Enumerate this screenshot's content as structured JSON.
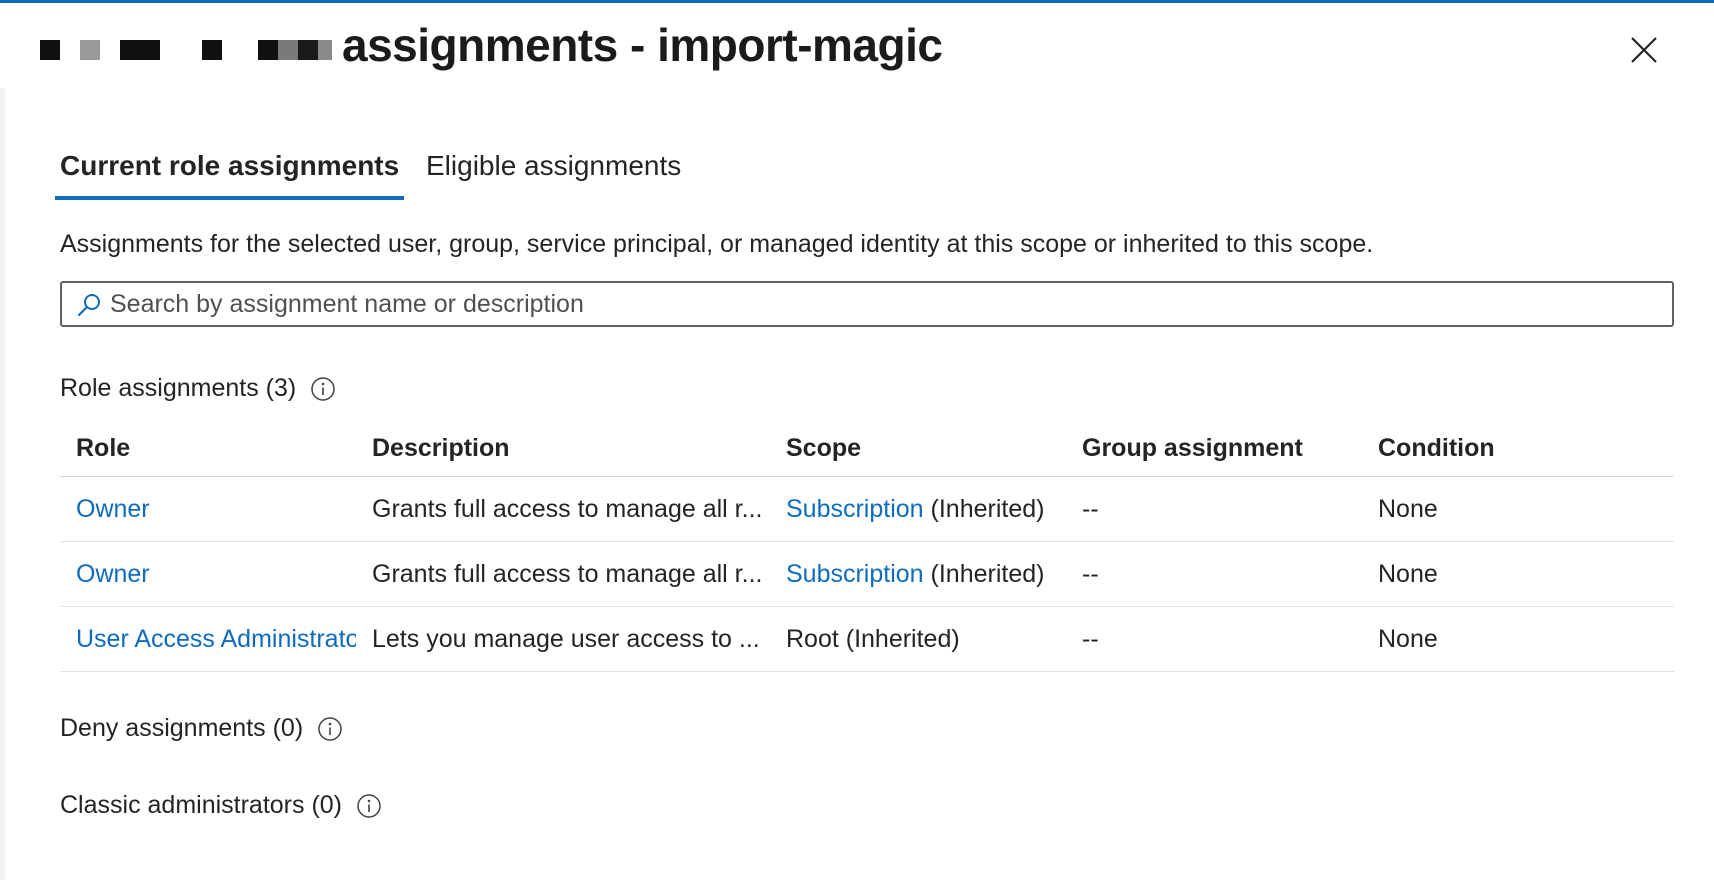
{
  "header": {
    "title": "assignments - import-magic",
    "close_icon": "close-icon",
    "accent_color": "#0f6cbd"
  },
  "tabs": [
    {
      "label": "Current role assignments",
      "active": true
    },
    {
      "label": "Eligible assignments",
      "active": false
    }
  ],
  "description": "Assignments for the selected user, group, service principal, or managed identity at this scope or inherited to this scope.",
  "search": {
    "placeholder": "Search by assignment name or description",
    "value": ""
  },
  "role_assignments": {
    "header": "Role assignments (3)",
    "columns": {
      "role": "Role",
      "description": "Description",
      "scope": "Scope",
      "group": "Group assignment",
      "condition": "Condition"
    },
    "rows": [
      {
        "role": "Owner",
        "description": "Grants full access to manage all r...",
        "scope_link": "Subscription",
        "scope_suffix": " (Inherited)",
        "group": "--",
        "condition": "None"
      },
      {
        "role": "Owner",
        "description": "Grants full access to manage all r...",
        "scope_link": "Subscription",
        "scope_suffix": " (Inherited)",
        "group": "--",
        "condition": "None"
      },
      {
        "role": "User Access Administrator",
        "description": "Lets you manage user access to ...",
        "scope_link": "",
        "scope_suffix": "Root (Inherited)",
        "group": "--",
        "condition": "None"
      }
    ]
  },
  "deny_assignments": {
    "header": "Deny assignments (0)"
  },
  "classic_administrators": {
    "header": "Classic administrators (0)"
  }
}
